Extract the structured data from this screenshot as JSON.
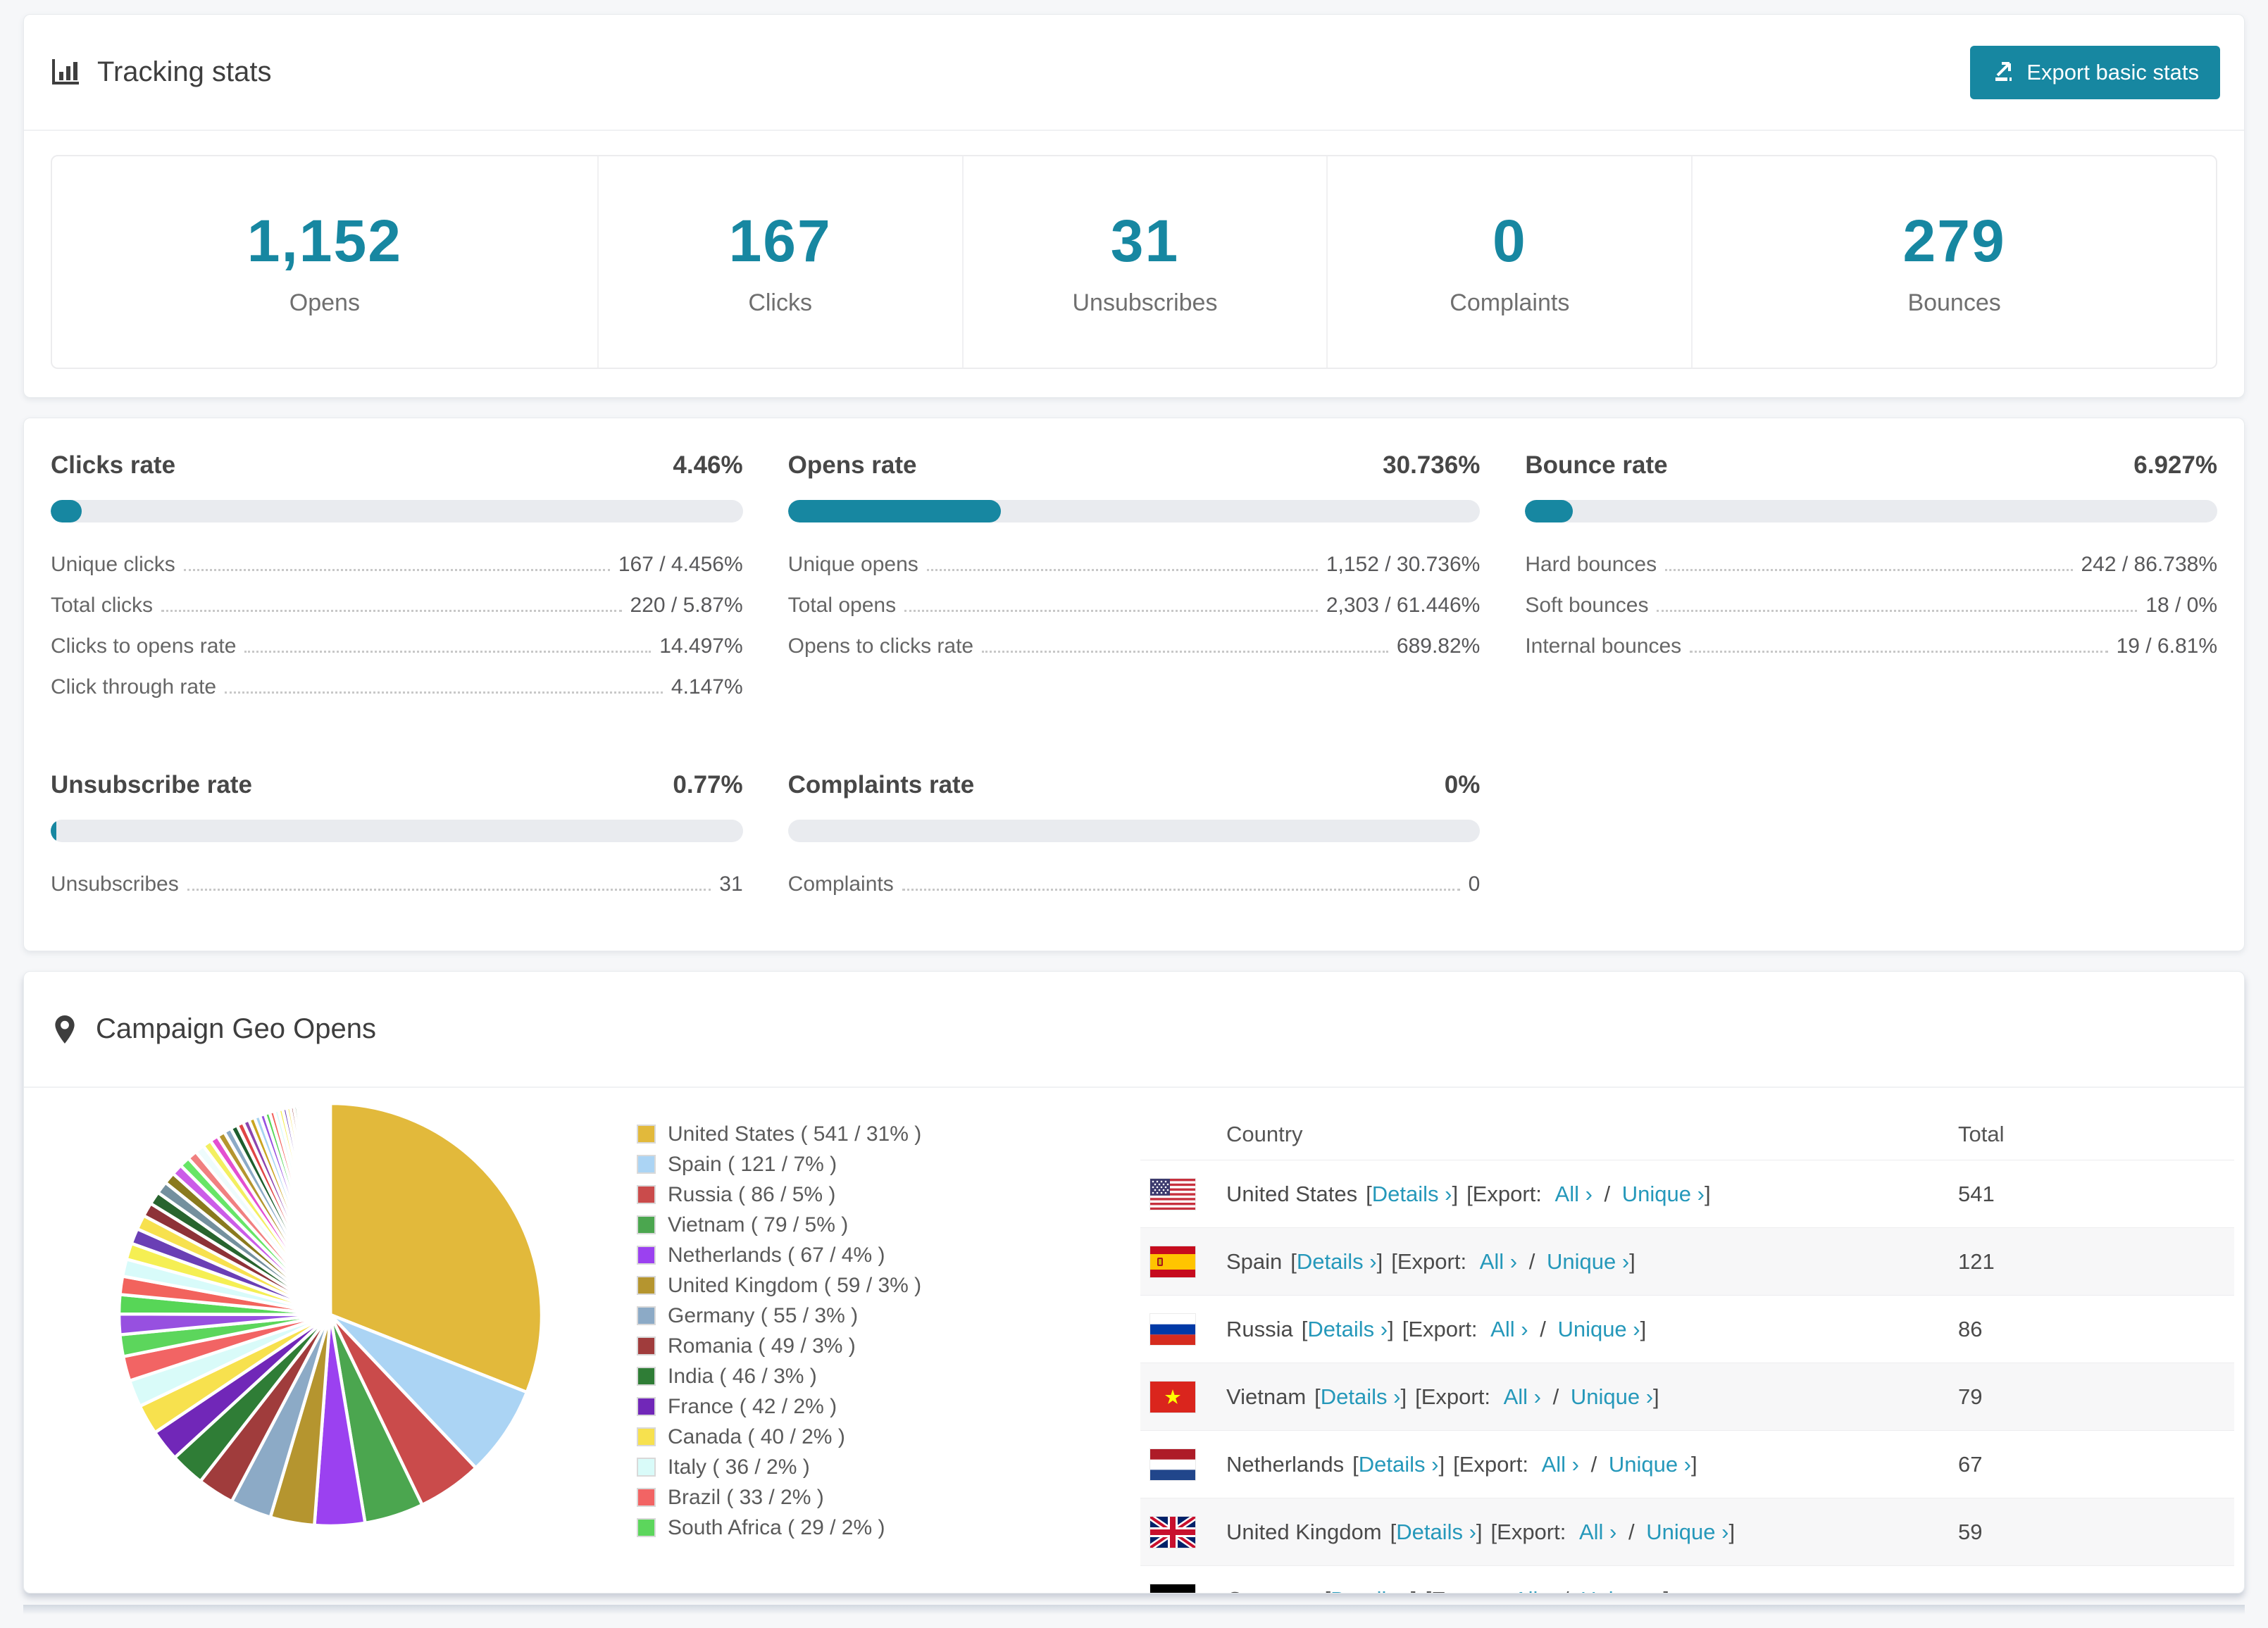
{
  "accent_color": "#1787a1",
  "link_color": "#2598ba",
  "tracking": {
    "title": "Tracking stats",
    "export_button": "Export basic stats",
    "stats": [
      {
        "value": "1,152",
        "label": "Opens"
      },
      {
        "value": "167",
        "label": "Clicks"
      },
      {
        "value": "31",
        "label": "Unsubscribes"
      },
      {
        "value": "0",
        "label": "Complaints"
      },
      {
        "value": "279",
        "label": "Bounces"
      }
    ]
  },
  "rates": [
    {
      "title": "Clicks rate",
      "value": "4.46%",
      "percent": 4.46,
      "rows": [
        {
          "label": "Unique clicks",
          "value": "167 / 4.456%"
        },
        {
          "label": "Total clicks",
          "value": "220 / 5.87%"
        },
        {
          "label": "Clicks to opens rate",
          "value": "14.497%"
        },
        {
          "label": "Click through rate",
          "value": "4.147%"
        }
      ]
    },
    {
      "title": "Opens rate",
      "value": "30.736%",
      "percent": 30.736,
      "rows": [
        {
          "label": "Unique opens",
          "value": "1,152 / 30.736%"
        },
        {
          "label": "Total opens",
          "value": "2,303 / 61.446%"
        },
        {
          "label": "Opens to clicks rate",
          "value": "689.82%"
        }
      ]
    },
    {
      "title": "Bounce rate",
      "value": "6.927%",
      "percent": 6.927,
      "rows": [
        {
          "label": "Hard bounces",
          "value": "242 / 86.738%"
        },
        {
          "label": "Soft bounces",
          "value": "18 / 0%"
        },
        {
          "label": "Internal bounces",
          "value": "19 / 6.81%"
        }
      ]
    },
    {
      "title": "Unsubscribe rate",
      "value": "0.77%",
      "percent": 0.77,
      "rows": [
        {
          "label": "Unsubscribes",
          "value": "31"
        }
      ]
    },
    {
      "title": "Complaints rate",
      "value": "0%",
      "percent": 0,
      "rows": [
        {
          "label": "Complaints",
          "value": "0"
        }
      ]
    }
  ],
  "geo": {
    "title": "Campaign Geo Opens",
    "legend": [
      {
        "label": "United States ( 541 / 31% )",
        "color": "#e2b93b"
      },
      {
        "label": "Spain ( 121 / 7% )",
        "color": "#abd4f4"
      },
      {
        "label": "Russia ( 86 / 5% )",
        "color": "#ca4b4b"
      },
      {
        "label": "Vietnam ( 79 / 5% )",
        "color": "#4ba64f"
      },
      {
        "label": "Netherlands ( 67 / 4% )",
        "color": "#9b41f0"
      },
      {
        "label": "United Kingdom ( 59 / 3% )",
        "color": "#b5952f"
      },
      {
        "label": "Germany ( 55 / 3% )",
        "color": "#8caac6"
      },
      {
        "label": "Romania ( 49 / 3% )",
        "color": "#a03c3c"
      },
      {
        "label": "India ( 46 / 3% )",
        "color": "#2f7d36"
      },
      {
        "label": "France ( 42 / 2% )",
        "color": "#7127b8"
      },
      {
        "label": "Canada ( 40 / 2% )",
        "color": "#f7e14e"
      },
      {
        "label": "Italy ( 36 / 2% )",
        "color": "#d9fbf9"
      },
      {
        "label": "Brazil ( 33 / 2% )",
        "color": "#f26464"
      },
      {
        "label": "South Africa ( 29 / 2% )",
        "color": "#5cd65c"
      }
    ],
    "table": {
      "columns": [
        "Country",
        "Total"
      ],
      "link_labels": {
        "details": "Details ›",
        "all": "All ›",
        "unique": "Unique ›",
        "export_prefix": "[Export:",
        "bracket_open": "[",
        "bracket_close": "]",
        "slash": "/"
      },
      "rows": [
        {
          "country": "United States",
          "total": "541",
          "flag": "us"
        },
        {
          "country": "Spain",
          "total": "121",
          "flag": "es"
        },
        {
          "country": "Russia",
          "total": "86",
          "flag": "ru"
        },
        {
          "country": "Vietnam",
          "total": "79",
          "flag": "vn"
        },
        {
          "country": "Netherlands",
          "total": "67",
          "flag": "nl"
        },
        {
          "country": "United Kingdom",
          "total": "59",
          "flag": "gb"
        },
        {
          "country": "Germany",
          "total": "",
          "flag": "de"
        }
      ]
    }
  },
  "chart_data": {
    "type": "pie",
    "title": "Campaign Geo Opens",
    "unit": "opens",
    "labels": [
      "United States",
      "Spain",
      "Russia",
      "Vietnam",
      "Netherlands",
      "United Kingdom",
      "Germany",
      "Romania",
      "India",
      "France",
      "Canada",
      "Italy",
      "Brazil",
      "South Africa"
    ],
    "values": [
      541,
      121,
      86,
      79,
      67,
      59,
      55,
      49,
      46,
      42,
      40,
      36,
      33,
      29
    ],
    "percents": [
      31,
      7,
      5,
      5,
      4,
      3,
      3,
      3,
      3,
      2,
      2,
      2,
      2,
      2
    ],
    "colors": [
      "#e2b93b",
      "#abd4f4",
      "#ca4b4b",
      "#4ba64f",
      "#9b41f0",
      "#b5952f",
      "#8caac6",
      "#a03c3c",
      "#2f7d36",
      "#7127b8",
      "#f7e14e",
      "#d9fbf9",
      "#f26464",
      "#5cd65c"
    ],
    "others": {
      "estimated_total": 463,
      "slice_count": 48
    },
    "legend_position": "right",
    "start_angle_deg": 0,
    "direction": "clockwise"
  }
}
